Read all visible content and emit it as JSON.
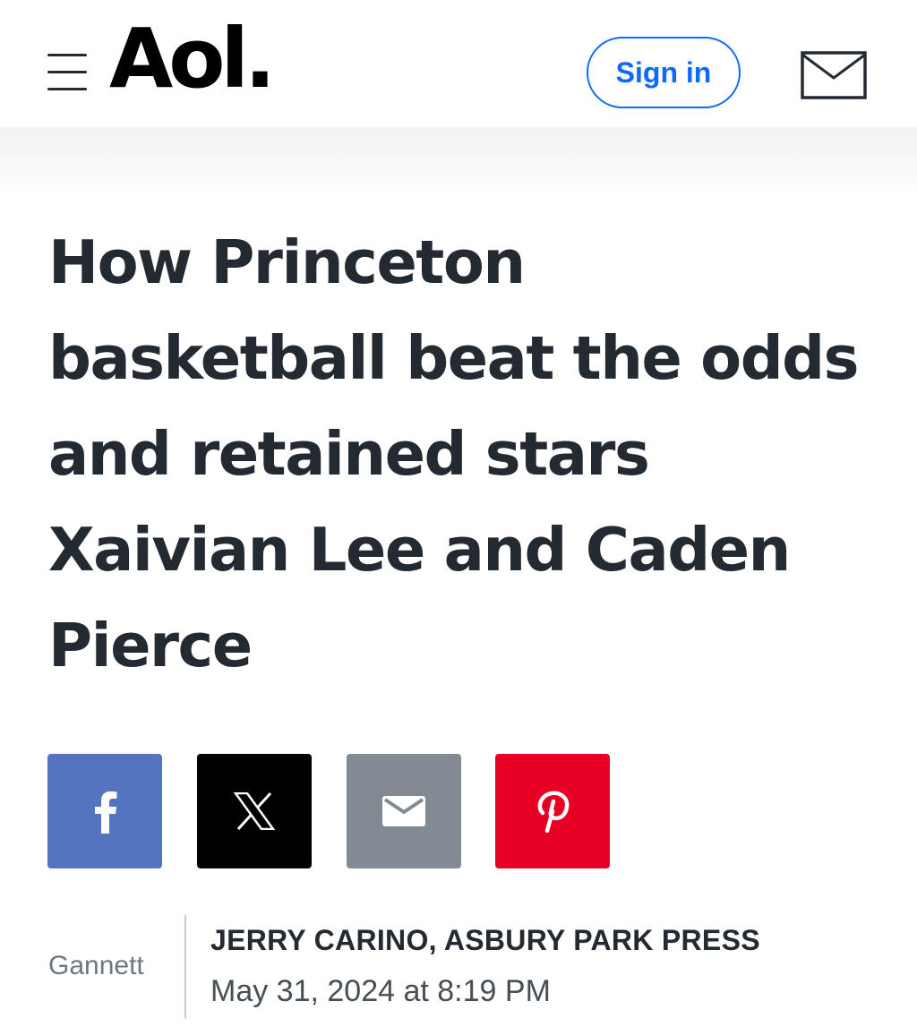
{
  "header": {
    "logo_text": "Aol.",
    "signin_label": "Sign in",
    "menu_icon": "hamburger-menu-icon",
    "mail_icon": "mail-envelope-icon",
    "accent_color": "#0f69ff"
  },
  "article": {
    "headline": "How Princeton basketball beat the odds and retained stars Xaivian Lee and Caden Pierce",
    "share_buttons": [
      {
        "name": "facebook",
        "icon": "facebook-icon",
        "color": "#5375bf"
      },
      {
        "name": "x",
        "icon": "x-icon",
        "color": "#000000"
      },
      {
        "name": "email",
        "icon": "email-icon",
        "color": "#828a93"
      },
      {
        "name": "pinterest",
        "icon": "pinterest-icon",
        "color": "#e60023"
      }
    ],
    "provider": "Gannett",
    "author": "JERRY CARINO, ASBURY PARK PRESS",
    "timestamp": "May 31, 2024 at 8:19 PM"
  }
}
